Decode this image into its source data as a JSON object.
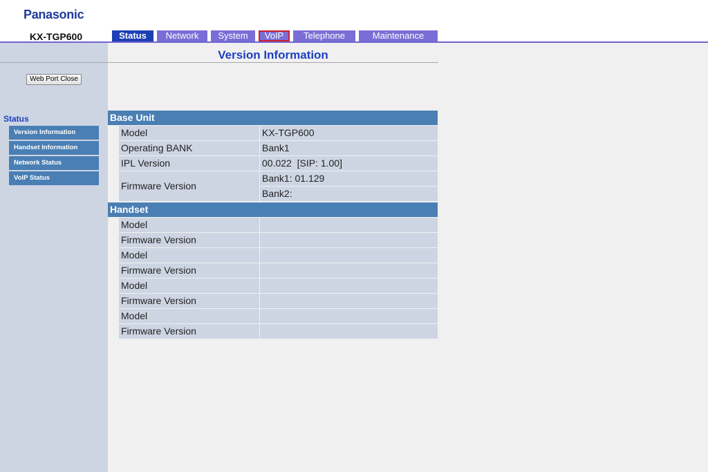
{
  "header": {
    "logo": "Panasonic",
    "model": "KX-TGP600"
  },
  "tabs": [
    {
      "label": "Status",
      "active": true
    },
    {
      "label": "Network",
      "active": false
    },
    {
      "label": "System",
      "active": false
    },
    {
      "label": "VoIP",
      "active": false,
      "highlighted": true
    },
    {
      "label": "Telephone",
      "active": false
    },
    {
      "label": "Maintenance",
      "active": false
    }
  ],
  "sidebar": {
    "button_label": "Web Port Close",
    "section_title": "Status",
    "items": [
      {
        "label": "Version Information"
      },
      {
        "label": "Handset Information"
      },
      {
        "label": "Network Status"
      },
      {
        "label": "VoIP Status"
      }
    ]
  },
  "main": {
    "title": "Version Information",
    "base_unit": {
      "title": "Base Unit",
      "rows": [
        {
          "label": "Model",
          "value": "KX-TGP600"
        },
        {
          "label": "Operating BANK",
          "value": "Bank1"
        },
        {
          "label": "IPL Version",
          "value": "00.022  [SIP: 1.00]"
        },
        {
          "label": "Firmware Version",
          "value_bank1": "Bank1: 01.129",
          "value_bank2": "Bank2:"
        }
      ]
    },
    "handset": {
      "title": "Handset",
      "rows": [
        {
          "label": "Model",
          "value": ""
        },
        {
          "label": "Firmware Version",
          "value": ""
        },
        {
          "label": "Model",
          "value": ""
        },
        {
          "label": "Firmware Version",
          "value": ""
        },
        {
          "label": "Model",
          "value": ""
        },
        {
          "label": "Firmware Version",
          "value": ""
        },
        {
          "label": "Model",
          "value": ""
        },
        {
          "label": "Firmware Version",
          "value": ""
        }
      ]
    }
  },
  "colors": {
    "tab_inactive": "#7a6ed6",
    "tab_active": "#1c3fb5",
    "tab_highlight_border": "#d01f27",
    "section_head": "#4a7fb4",
    "row_bg": "#cdd5e3",
    "title_text": "#1d3fc0"
  }
}
